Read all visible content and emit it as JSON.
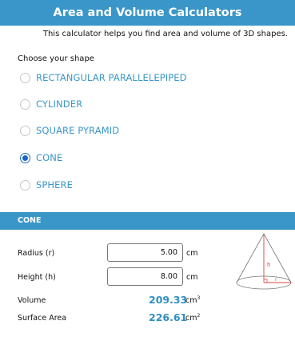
{
  "header": {
    "title": "Area and Volume Calculators",
    "subtitle": "This calculator helps you find area and volume of 3D shapes."
  },
  "shapes": {
    "prompt": "Choose your shape",
    "options": [
      {
        "label": "RECTANGULAR PARALLELEPIPED",
        "checked": false
      },
      {
        "label": "CYLINDER",
        "checked": false
      },
      {
        "label": "SQUARE PYRAMID",
        "checked": false
      },
      {
        "label": "CONE",
        "checked": true
      },
      {
        "label": "SPHERE",
        "checked": false
      }
    ]
  },
  "calculator": {
    "section_title": "CONE",
    "radius": {
      "label": "Radius (r)",
      "value": "5.00",
      "unit": "cm"
    },
    "height": {
      "label": "Height (h)",
      "value": "8.00",
      "unit": "cm"
    },
    "volume": {
      "label": "Volume",
      "value": "209.33",
      "unit": "cm",
      "unit_power": "3"
    },
    "surface_area": {
      "label": "Surface Area",
      "value": "226.61",
      "unit": "cm",
      "unit_power": "2"
    },
    "diagram": {
      "height_label": "h",
      "radius_label": "r"
    }
  },
  "colors": {
    "accent": "#3a96c8",
    "radio_selected": "#1a64c2",
    "diagram_highlight": "#d9443f"
  }
}
